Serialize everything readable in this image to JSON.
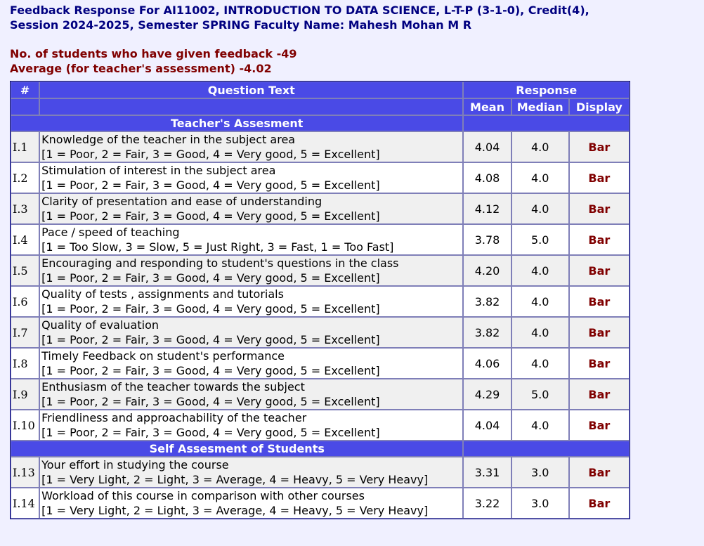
{
  "header": {
    "title_line1": "Feedback Response For AI11002, INTRODUCTION TO DATA SCIENCE, L-T-P (3-1-0), Credit(4),",
    "title_line2": "Session 2024-2025, Semester SPRING Faculty Name: Mahesh Mohan M R",
    "students_feedback": "No. of students who have given feedback -49",
    "average": "Average (for teacher's assessment) -4.02"
  },
  "table": {
    "col_num": "#",
    "col_question": "Question Text",
    "col_response": "Response",
    "col_mean": "Mean",
    "col_median": "Median",
    "col_display": "Display",
    "sections": [
      {
        "title": "Teacher's Assesment",
        "rows": [
          {
            "id": "I.1",
            "q": "Knowledge of the teacher in the subject area",
            "scale": "[1 = Poor, 2 = Fair, 3 = Good, 4 = Very good, 5 = Excellent]",
            "mean": "4.04",
            "median": "4.0",
            "display": "Bar"
          },
          {
            "id": "I.2",
            "q": "Stimulation of interest in the subject area",
            "scale": "[1 = Poor, 2 = Fair, 3 = Good, 4 = Very good, 5 = Excellent]",
            "mean": "4.08",
            "median": "4.0",
            "display": "Bar"
          },
          {
            "id": "I.3",
            "q": "Clarity of presentation and ease of understanding",
            "scale": "[1 = Poor, 2 = Fair, 3 = Good, 4 = Very good, 5 = Excellent]",
            "mean": "4.12",
            "median": "4.0",
            "display": "Bar"
          },
          {
            "id": "I.4",
            "q": "Pace / speed of teaching",
            "scale": "[1 = Too Slow, 3 = Slow, 5 = Just Right, 3 = Fast, 1 = Too Fast]",
            "mean": "3.78",
            "median": "5.0",
            "display": "Bar"
          },
          {
            "id": "I.5",
            "q": "Encouraging and responding to student's questions in the class",
            "scale": "[1 = Poor, 2 = Fair, 3 = Good, 4 = Very good, 5 = Excellent]",
            "mean": "4.20",
            "median": "4.0",
            "display": "Bar"
          },
          {
            "id": "I.6",
            "q": "Quality of tests , assignments and tutorials",
            "scale": "[1 = Poor, 2 = Fair, 3 = Good, 4 = Very good, 5 = Excellent]",
            "mean": "3.82",
            "median": "4.0",
            "display": "Bar"
          },
          {
            "id": "I.7",
            "q": "Quality of evaluation",
            "scale": "[1 = Poor, 2 = Fair, 3 = Good, 4 = Very good, 5 = Excellent]",
            "mean": "3.82",
            "median": "4.0",
            "display": "Bar"
          },
          {
            "id": "I.8",
            "q": "Timely Feedback on student's performance",
            "scale": "[1 = Poor, 2 = Fair, 3 = Good, 4 = Very good, 5 = Excellent]",
            "mean": "4.06",
            "median": "4.0",
            "display": "Bar"
          },
          {
            "id": "I.9",
            "q": "Enthusiasm of the teacher towards the subject",
            "scale": "[1 = Poor, 2 = Fair, 3 = Good, 4 = Very good, 5 = Excellent]",
            "mean": "4.29",
            "median": "5.0",
            "display": "Bar"
          },
          {
            "id": "I.10",
            "q": "Friendliness and approachability of the teacher",
            "scale": "[1 = Poor, 2 = Fair, 3 = Good, 4 = Very good, 5 = Excellent]",
            "mean": "4.04",
            "median": "4.0",
            "display": "Bar"
          }
        ]
      },
      {
        "title": "Self Assesment of Students",
        "rows": [
          {
            "id": "I.13",
            "q": "Your effort in studying the course",
            "scale": "[1 = Very Light, 2 = Light, 3 = Average, 4 = Heavy, 5 = Very Heavy]",
            "mean": "3.31",
            "median": "3.0",
            "display": "Bar"
          },
          {
            "id": "I.14",
            "q": "Workload of this course in comparison with other courses",
            "scale": "[1 = Very Light, 2 = Light, 3 = Average, 4 = Heavy, 5 = Very Heavy]",
            "mean": "3.22",
            "median": "3.0",
            "display": "Bar"
          }
        ]
      }
    ]
  }
}
